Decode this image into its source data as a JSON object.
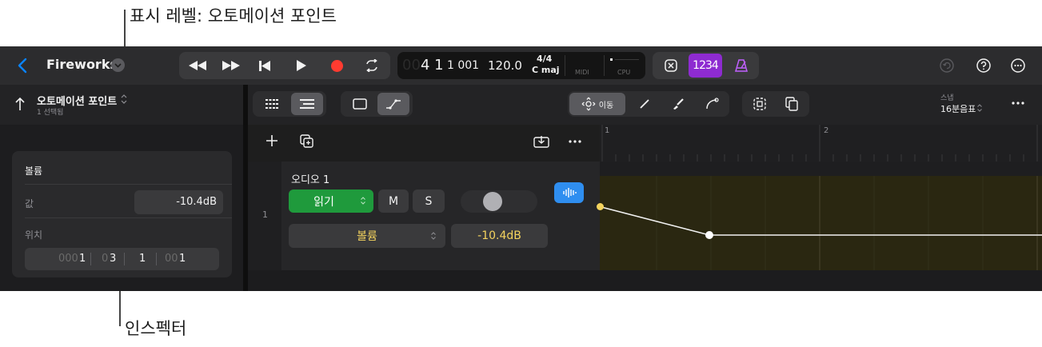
{
  "callouts": {
    "top": "표시 레벨: 오토메이션 포인트",
    "bottom": "인스펙터"
  },
  "project": {
    "title": "Fireworks"
  },
  "lcd": {
    "position": "4 1",
    "ticks": "1 001",
    "tempo": "120.0",
    "signature": "4/4",
    "key": "C maj",
    "midi_label": "MIDI",
    "cpu_label": "CPU"
  },
  "count_in_label": "1234",
  "inspector": {
    "title": "오토메이션 포인트",
    "subtitle": "1 선택됨",
    "section": "볼륨",
    "value_label": "값",
    "value": "-10.4dB",
    "position_label": "위치",
    "position": {
      "bar_dim": "000",
      "bar": "1",
      "beat_dim": "0",
      "beat": "3",
      "div": "1",
      "tick_dim": "00",
      "tick": "1"
    }
  },
  "tools": {
    "move_label": "이동"
  },
  "snap": {
    "label": "스냅",
    "value": "16분음표"
  },
  "track": {
    "number": "1",
    "name": "오디오 1",
    "read_mode": "읽기",
    "mute": "M",
    "solo": "S",
    "param": "볼륨",
    "param_value": "-10.4dB"
  },
  "ruler": {
    "bar1": "1",
    "bar2": "2"
  },
  "colors": {
    "accent": "#0a84ff",
    "record": "#ff3b30",
    "read_green": "#1f9a3c",
    "yellow_value": "#f4d35e",
    "count_in": "#8e2bd1"
  }
}
